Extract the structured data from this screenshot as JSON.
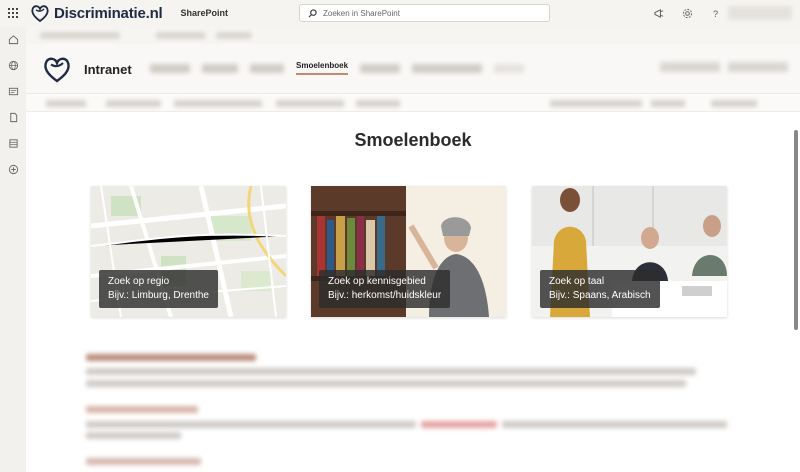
{
  "suite": {
    "org_name": "Discriminatie.nl",
    "app_name": "SharePoint",
    "search_placeholder": "Zoeken in SharePoint",
    "icons": [
      "waffle-icon",
      "megaphone-icon",
      "gear-icon",
      "help-icon"
    ]
  },
  "rail": {
    "icons": [
      "home-icon",
      "globe-icon",
      "news-icon",
      "file-icon",
      "list-icon",
      "add-icon"
    ]
  },
  "site": {
    "title": "Intranet",
    "nav_active": "Smoelenboek"
  },
  "page": {
    "title": "Smoelenboek"
  },
  "cards": [
    {
      "title": "Zoek op regio",
      "subtitle": "Bijv.: Limburg, Drenthe"
    },
    {
      "title": "Zoek op kennisgebied",
      "subtitle": "Bijv.: herkomst/huidskleur"
    },
    {
      "title": "Zoek op taal",
      "subtitle": "Bijv.: Spaans, Arabisch"
    }
  ],
  "colors": {
    "accent": "#c48a6b",
    "brand": "#1f2a44"
  }
}
